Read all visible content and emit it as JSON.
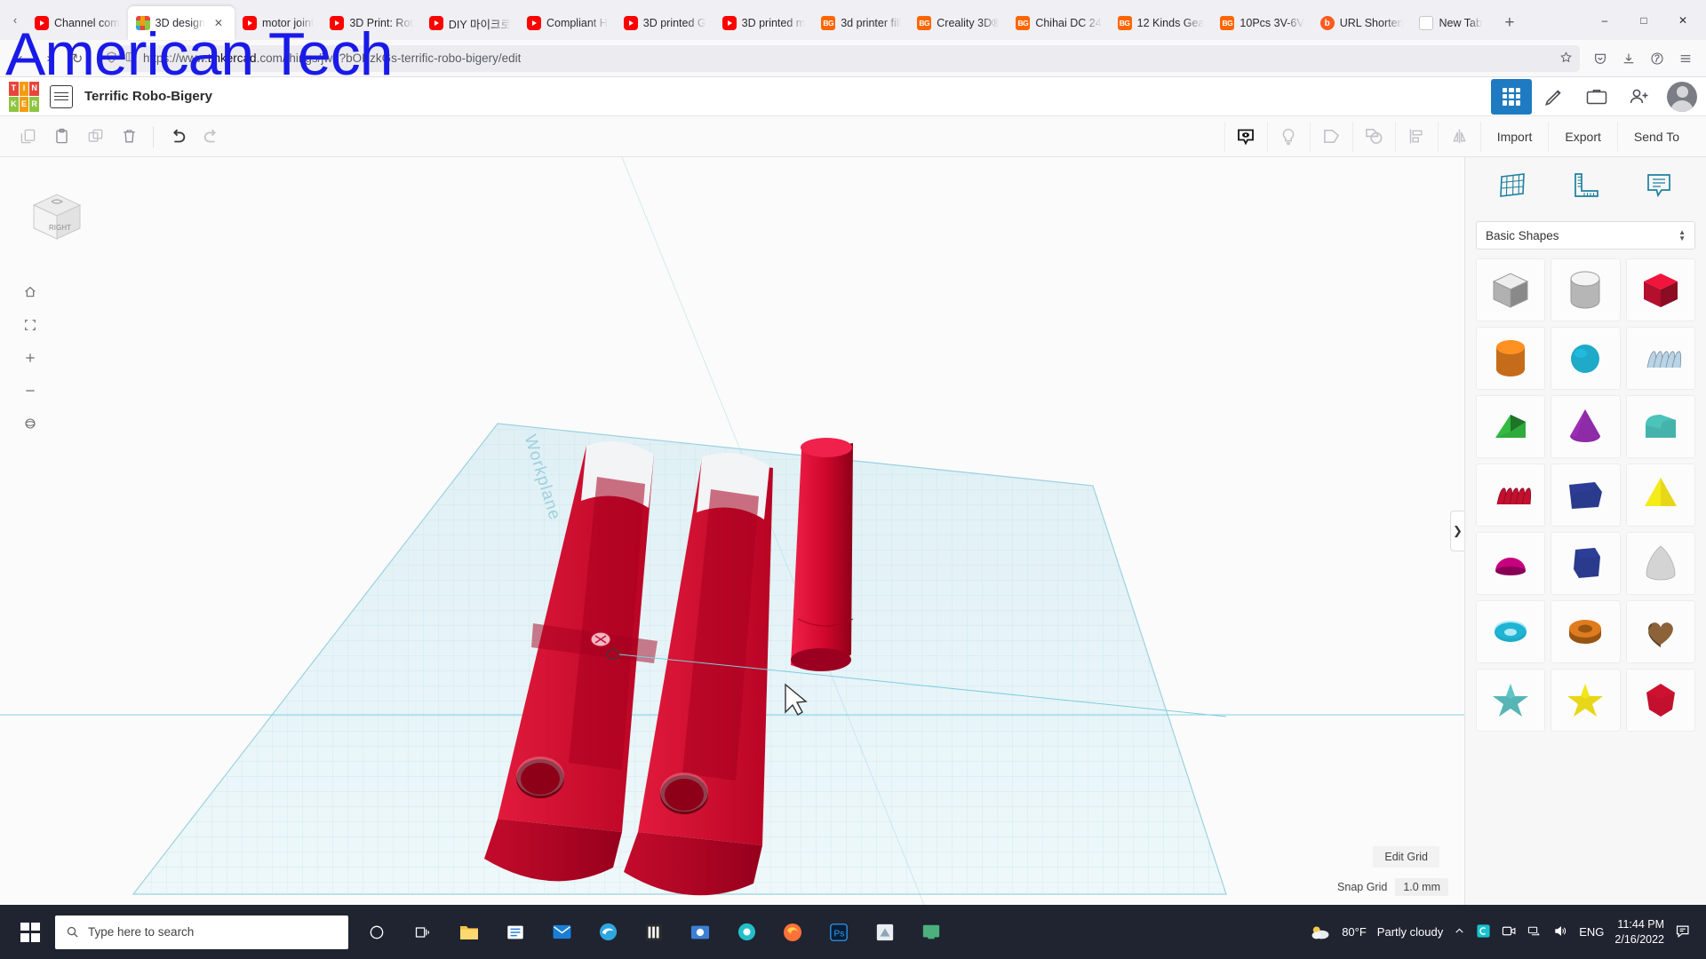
{
  "browser": {
    "tabs": [
      {
        "label": "Channel com",
        "icon": "youtube-icon",
        "active": false
      },
      {
        "label": "3D design",
        "icon": "tinkercad-icon",
        "active": true
      },
      {
        "label": "motor joint",
        "icon": "youtube-icon",
        "active": false
      },
      {
        "label": "3D Print: Rot",
        "icon": "youtube-icon",
        "active": false
      },
      {
        "label": "DIY 마이크로",
        "icon": "youtube-icon",
        "active": false
      },
      {
        "label": "Compliant H",
        "icon": "youtube-icon",
        "active": false
      },
      {
        "label": "3D printed G",
        "icon": "youtube-icon",
        "active": false
      },
      {
        "label": "3D printed m",
        "icon": "youtube-icon",
        "active": false
      },
      {
        "label": "3d printer fill",
        "icon": "banggood-icon",
        "active": false
      },
      {
        "label": "Creality 3D®",
        "icon": "banggood-icon",
        "active": false
      },
      {
        "label": "Chihai DC 24",
        "icon": "banggood-icon",
        "active": false
      },
      {
        "label": "12 Kinds Gea",
        "icon": "banggood-icon",
        "active": false
      },
      {
        "label": "10Pcs 3V-6V",
        "icon": "banggood-icon",
        "active": false
      },
      {
        "label": "URL Shorten",
        "icon": "bitly-icon",
        "active": false
      },
      {
        "label": "New Tab",
        "icon": "newtab-icon",
        "active": false
      }
    ],
    "new_tab_label": "+",
    "window_buttons": {
      "minimize": "–",
      "maximize": "□",
      "close": "✕"
    },
    "url": {
      "scheme": "https://www.",
      "domain": "tinkercad",
      "rest": ".com/things/jw9?bOBzkGs-terrific-robo-bigery/edit",
      "full": "https://www.tinkercad.com/things/jw9?bOBzkGs-terrific-robo-bigery/edit"
    },
    "nav": {
      "back": "‹",
      "forward": "›",
      "reload": "↻"
    },
    "toolbar_icons": [
      "shield-icon",
      "bookmark-icon",
      "star-icon",
      "pocket-icon",
      "download-icon",
      "pinterest-icon",
      "menu-icon"
    ]
  },
  "watermark": {
    "text": "American Tech",
    "color": "#1a1ae8"
  },
  "tinkercad": {
    "logo_letters": [
      "T",
      "I",
      "N",
      "K",
      "E",
      "R"
    ],
    "logo_colors": [
      "#e8453c",
      "#f39c12",
      "#e8453c",
      "#8dc63f",
      "#f39c12",
      "#8dc63f"
    ],
    "project_title": "Terrific Robo-Bigery",
    "header_buttons": [
      {
        "name": "apps-grid-button",
        "selected": true
      },
      {
        "name": "learn-pencil-button",
        "selected": false
      },
      {
        "name": "gallery-button",
        "selected": false
      },
      {
        "name": "add-person-button",
        "selected": false
      }
    ],
    "toolbar_left": [
      "copy-icon",
      "paste-icon",
      "duplicate-icon",
      "delete-icon",
      "undo-icon",
      "redo-icon"
    ],
    "toolbar_right_icons": [
      "view-eye-icon",
      "lightbulb-icon",
      "group-icon",
      "ungroup-icon",
      "align-icon",
      "mirror-icon"
    ],
    "import_label": "Import",
    "export_label": "Export",
    "send_to_label": "Send To",
    "viewcube_label": "RIGHT",
    "nav_tools": [
      "home-view-icon",
      "fit-view-icon",
      "zoom-in-icon",
      "zoom-out-icon",
      "orbit-icon"
    ],
    "workplane_label": "Workplane",
    "edit_grid_label": "Edit Grid",
    "snap_grid_label": "Snap Grid",
    "snap_grid_value": "1.0 mm",
    "panel_collapse_arrow": "❯",
    "panel": {
      "top_icons": [
        "workplane-icon",
        "ruler-icon",
        "note-icon"
      ],
      "category_label": "Basic Shapes",
      "shapes": [
        {
          "name": "box-hole-shape",
          "color": "#c9c9c9",
          "kind": "box",
          "hole": true
        },
        {
          "name": "cylinder-hole-shape",
          "color": "#cfcfcf",
          "kind": "cylinder",
          "hole": true
        },
        {
          "name": "box-shape",
          "color": "#cc1133",
          "kind": "box",
          "hole": false
        },
        {
          "name": "cylinder-shape",
          "color": "#e07b1e",
          "kind": "cylinder",
          "hole": false
        },
        {
          "name": "sphere-shape",
          "color": "#1eaac8",
          "kind": "sphere",
          "hole": false
        },
        {
          "name": "scribble-shape",
          "color": "#b9d4e6",
          "kind": "scribble",
          "hole": false
        },
        {
          "name": "wedge-shape",
          "color": "#2eab3c",
          "kind": "wedge",
          "hole": false
        },
        {
          "name": "cone-shape",
          "color": "#8e2ba8",
          "kind": "cone",
          "hole": false
        },
        {
          "name": "roof-shape",
          "color": "#45b2ab",
          "kind": "roof",
          "hole": false
        },
        {
          "name": "text-shape",
          "color": "#c3102f",
          "kind": "text",
          "hole": false
        },
        {
          "name": "polygon-shape",
          "color": "#2a3a8c",
          "kind": "polygon",
          "hole": false
        },
        {
          "name": "pyramid-shape",
          "color": "#e8d618",
          "kind": "pyramid",
          "hole": false
        },
        {
          "name": "halfsphere-shape",
          "color": "#c6007e",
          "kind": "halfsphere",
          "hole": false
        },
        {
          "name": "hexprism-shape",
          "color": "#2a3a8c",
          "kind": "hexprism",
          "hole": false
        },
        {
          "name": "paraboloid-shape",
          "color": "#d4d4d4",
          "kind": "paraboloid",
          "hole": false
        },
        {
          "name": "torus-shape",
          "color": "#1eaac8",
          "kind": "torus",
          "hole": false
        },
        {
          "name": "tube-shape",
          "color": "#e07b1e",
          "kind": "tube",
          "hole": false
        },
        {
          "name": "heart-shape",
          "color": "#8c6239",
          "kind": "heart",
          "hole": false
        },
        {
          "name": "star-teal-shape",
          "color": "#58b5b5",
          "kind": "star",
          "hole": false
        },
        {
          "name": "star-yellow-shape",
          "color": "#e8d618",
          "kind": "star",
          "hole": false
        },
        {
          "name": "gem-shape",
          "color": "#c3102f",
          "kind": "gem",
          "hole": false
        }
      ]
    },
    "model": {
      "part_color": "#d1072c",
      "parts": 3
    }
  },
  "taskbar": {
    "search_placeholder": "Type here to search",
    "items": [
      "task-view-icon",
      "cortana-icon",
      "file-explorer-icon",
      "store-icon",
      "mail-icon",
      "edge-icon",
      "vlc-icon",
      "capture-icon",
      "chrome-icon",
      "firefox-icon",
      "photoshop-icon",
      "sketch-icon",
      "other-app-icon"
    ],
    "weather_temp": "80°F",
    "weather_desc": "Partly cloudy",
    "language": "ENG",
    "time": "11:44 PM",
    "date": "2/16/2022",
    "tray_icons": [
      "chevron-up-icon",
      "cortana-circle-icon",
      "camera-icon",
      "network-icon",
      "volume-icon"
    ],
    "notification_icon": "notifications-icon"
  }
}
